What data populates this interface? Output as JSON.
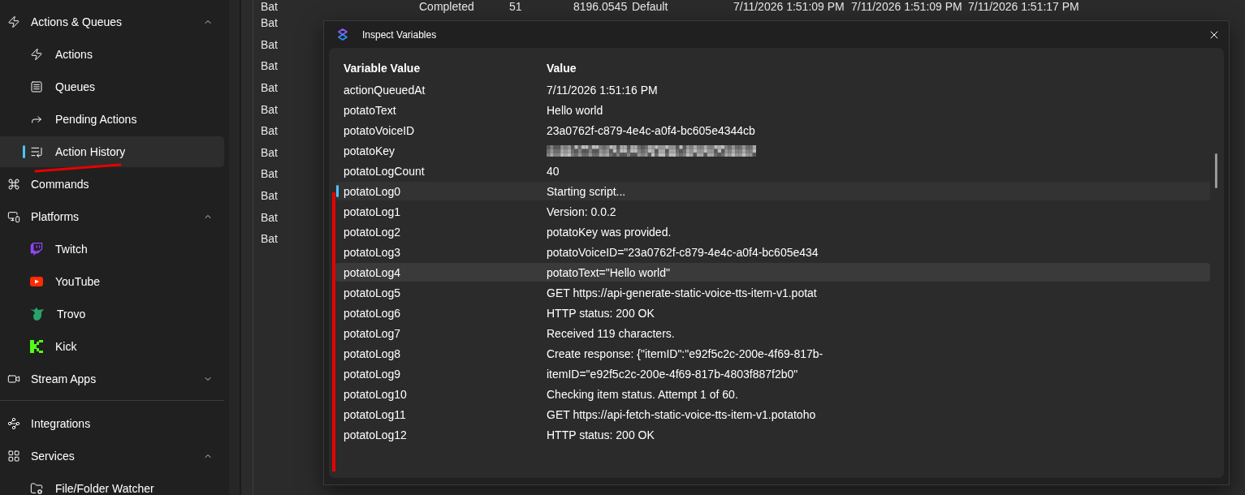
{
  "sidebar": {
    "items": [
      {
        "kind": "group",
        "label": "Actions & Queues",
        "selected": false,
        "expanded": true,
        "children": [
          {
            "label": "Actions",
            "selected": false
          },
          {
            "label": "Queues",
            "selected": false
          },
          {
            "label": "Pending Actions",
            "selected": false
          },
          {
            "label": "Action History",
            "selected": true
          }
        ]
      },
      {
        "kind": "link",
        "label": "Commands",
        "selected": false
      },
      {
        "kind": "group",
        "label": "Platforms",
        "selected": false,
        "expanded": true,
        "children": [
          {
            "label": "Twitch",
            "selected": false
          },
          {
            "label": "YouTube",
            "selected": false
          },
          {
            "label": "Trovo",
            "selected": false
          },
          {
            "label": "Kick",
            "selected": false
          }
        ]
      },
      {
        "kind": "group",
        "label": "Stream Apps",
        "selected": false,
        "expanded": false
      },
      {
        "kind": "divider"
      },
      {
        "kind": "link",
        "label": "Integrations",
        "selected": false
      },
      {
        "kind": "group",
        "label": "Services",
        "selected": false,
        "expanded": true,
        "children": [
          {
            "label": "File/Folder Watcher",
            "selected": false
          }
        ]
      }
    ]
  },
  "history_table": {
    "rows": [
      {
        "cells": [
          "Bat",
          "Completed",
          "51",
          "8196.0545",
          "Default",
          "7/11/2026 1:51:09 PM",
          "7/11/2026 1:51:09 PM",
          "7/11/2026 1:51:17 PM"
        ]
      },
      {
        "cells": [
          "Bat"
        ]
      },
      {
        "cells": [
          "Bat"
        ]
      },
      {
        "cells": [
          "Bat"
        ]
      },
      {
        "cells": [
          "Bat"
        ]
      },
      {
        "cells": [
          "Bat"
        ]
      },
      {
        "cells": [
          "Bat"
        ]
      },
      {
        "cells": [
          "Bat"
        ]
      },
      {
        "cells": [
          "Bat"
        ]
      },
      {
        "cells": [
          "Bat"
        ]
      },
      {
        "cells": [
          "Bat"
        ]
      },
      {
        "cells": [
          "Bat"
        ]
      }
    ]
  },
  "dialog": {
    "title": "Inspect Variables",
    "columns": [
      "Variable Value",
      "Value"
    ],
    "rows": [
      {
        "name": "actionQueuedAt",
        "kind": "text",
        "value": "7/11/2026 1:51:16 PM",
        "selected": false,
        "hovered": false
      },
      {
        "name": "potatoText",
        "kind": "text",
        "value": "Hello world",
        "selected": false,
        "hovered": false
      },
      {
        "name": "potatoVoiceID",
        "kind": "text",
        "value": "23a0762f-c879-4e4c-a0f4-bc605e4344cb",
        "selected": false,
        "hovered": false
      },
      {
        "name": "potatoKey",
        "kind": "redacted",
        "selected": false,
        "hovered": false
      },
      {
        "name": "potatoLogCount",
        "kind": "text",
        "value": "40",
        "selected": false,
        "hovered": false
      },
      {
        "name": "potatoLog0",
        "kind": "text",
        "value": "Starting script...",
        "selected": true,
        "hovered": false
      },
      {
        "name": "potatoLog1",
        "kind": "text",
        "value": "Version: 0.0.2",
        "selected": false,
        "hovered": false
      },
      {
        "name": "potatoLog2",
        "kind": "text",
        "value": "potatoKey was provided.",
        "selected": false,
        "hovered": false
      },
      {
        "name": "potatoLog3",
        "kind": "text",
        "value": "potatoVoiceID=\"23a0762f-c879-4e4c-a0f4-bc605e434",
        "selected": false,
        "hovered": false
      },
      {
        "name": "potatoLog4",
        "kind": "text",
        "value": "potatoText=\"Hello world\"",
        "selected": false,
        "hovered": true
      },
      {
        "name": "potatoLog5",
        "kind": "text",
        "value": "GET https://api-generate-static-voice-tts-item-v1.potat",
        "selected": false,
        "hovered": false
      },
      {
        "name": "potatoLog6",
        "kind": "text",
        "value": "HTTP status: 200 OK",
        "selected": false,
        "hovered": false
      },
      {
        "name": "potatoLog7",
        "kind": "text",
        "value": "Received 119 characters.",
        "selected": false,
        "hovered": false
      },
      {
        "name": "potatoLog8",
        "kind": "text",
        "value": "Create response: {\"itemID\":\"e92f5c2c-200e-4f69-817b-",
        "selected": false,
        "hovered": false
      },
      {
        "name": "potatoLog9",
        "kind": "text",
        "value": "itemID=\"e92f5c2c-200e-4f69-817b-4803f887f2b0\"",
        "selected": false,
        "hovered": false
      },
      {
        "name": "potatoLog10",
        "kind": "text",
        "value": "Checking item status. Attempt 1 of 60.",
        "selected": false,
        "hovered": false
      },
      {
        "name": "potatoLog11",
        "kind": "text",
        "value": "GET https://api-fetch-static-voice-tts-item-v1.potatoho",
        "selected": false,
        "hovered": false
      },
      {
        "name": "potatoLog12",
        "kind": "text",
        "value": "HTTP status: 200 OK",
        "selected": false,
        "hovered": false
      }
    ]
  }
}
